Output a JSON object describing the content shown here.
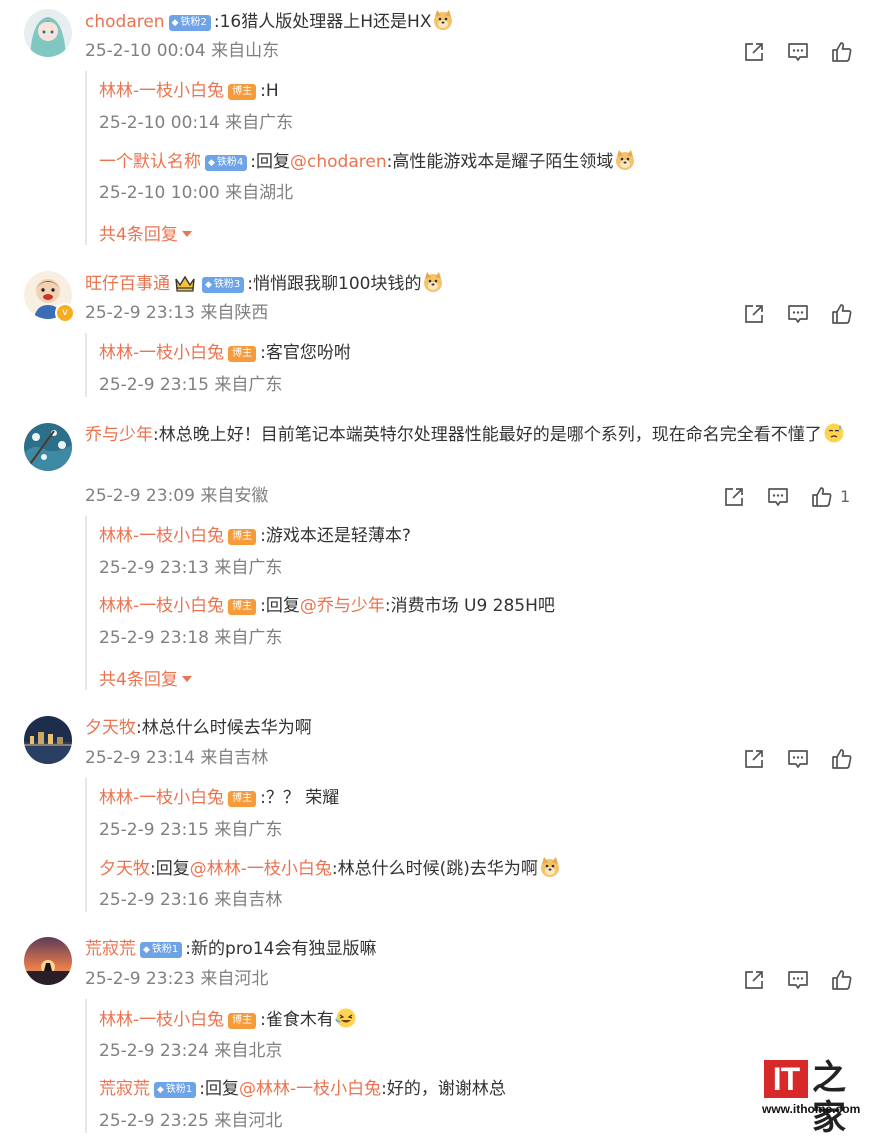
{
  "brand": {
    "logo_mark": "IT",
    "logo_chars": "之家",
    "url": "www.ithome.com",
    "accent_color": "#eb7350",
    "logo_color": "#d7282a"
  },
  "icons": {
    "share": "share-icon",
    "comment": "comment-icon",
    "like": "thumbs-up-icon",
    "expand": "caret-down-icon"
  },
  "comments": [
    {
      "user": "chodaren",
      "fan_badge": "铁粉2",
      "text": ":16猎人版处理器上H还是HX",
      "emoji": "doge",
      "meta": "25-2-10 00:04 来自山东",
      "replies": [
        {
          "user": "林林-一枝小白兔",
          "host_badge": "博主",
          "text": ":H",
          "meta": "25-2-10 00:14 来自广东"
        },
        {
          "user": "一个默认名称",
          "fan_badge": "铁粉4",
          "text_pre": ":回复",
          "mention": "@chodaren",
          "text": ":高性能游戏本是耀子陌生领域",
          "emoji": "doge",
          "meta": "25-2-10 10:00 来自湖北"
        }
      ],
      "more_replies": "共4条回复"
    },
    {
      "user": "旺仔百事通",
      "fan_badge": "铁粉3",
      "text": ":悄悄跟我聊100块钱的",
      "emoji": "doge",
      "meta": "25-2-9 23:13 来自陕西",
      "verified": "v",
      "replies": [
        {
          "user": "林林-一枝小白兔",
          "host_badge": "博主",
          "text": ":客官您吩咐",
          "meta": "25-2-9 23:15 来自广东"
        }
      ]
    },
    {
      "user": "乔与少年",
      "text": ":林总晚上好！目前笔记本端英特尔处理器性能最好的是哪个系列，现在命名完全看不懂了",
      "emoji": "sweat",
      "meta": "25-2-9 23:09 来自安徽",
      "like_count": "1",
      "replies": [
        {
          "user": "林林-一枝小白兔",
          "host_badge": "博主",
          "text": ":游戏本还是轻薄本?",
          "meta": "25-2-9 23:13 来自广东"
        },
        {
          "user": "林林-一枝小白兔",
          "host_badge": "博主",
          "text_pre": ":回复",
          "mention": "@乔与少年",
          "text": ":消费市场 U9 285H吧",
          "meta": "25-2-9 23:18 来自广东"
        }
      ],
      "more_replies": "共4条回复"
    },
    {
      "user": "夕天牧",
      "text": ":林总什么时候去华为啊",
      "meta": "25-2-9 23:14 来自吉林",
      "replies": [
        {
          "user": "林林-一枝小白兔",
          "host_badge": "博主",
          "text": ":？？ 荣耀",
          "meta": "25-2-9 23:15 来自广东"
        },
        {
          "user": "夕天牧",
          "text_pre": ":回复",
          "mention": "@林林-一枝小白兔",
          "text": ":林总什么时候(跳)去华为啊",
          "emoji": "doge",
          "meta": "25-2-9 23:16 来自吉林"
        }
      ]
    },
    {
      "user": "荒寂荒",
      "fan_badge": "铁粉1",
      "text": ":新的pro14会有独显版嘛",
      "meta": "25-2-9 23:23 来自河北",
      "replies": [
        {
          "user": "林林-一枝小白兔",
          "host_badge": "博主",
          "text": ":雀食木有",
          "emoji": "laugh",
          "meta": "25-2-9 23:24 来自北京"
        },
        {
          "user": "荒寂荒",
          "fan_badge": "铁粉1",
          "text_pre": ":回复",
          "mention": "@林林-一枝小白兔",
          "text": ":好的，谢谢林总",
          "meta": "25-2-9 23:25 来自河北"
        }
      ]
    }
  ]
}
